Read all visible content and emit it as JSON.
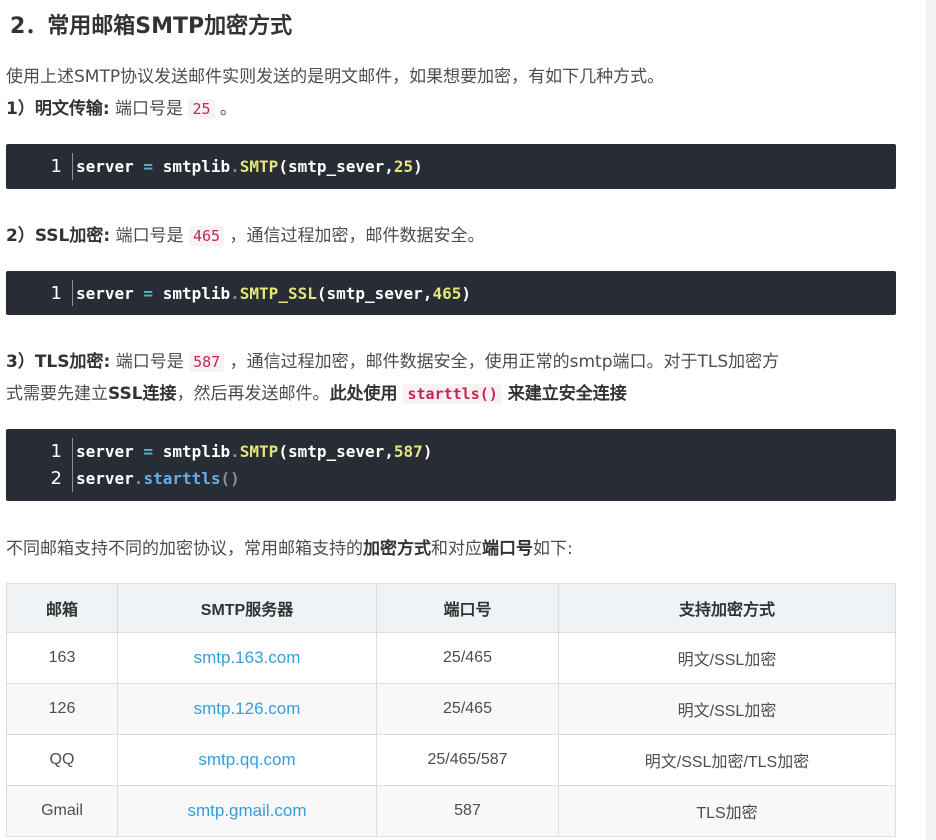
{
  "heading": "2．常用邮箱SMTP加密方式",
  "intro": "使用上述SMTP协议发送邮件实则发送的是明文邮件，如果想要加密，有如下几种方式。",
  "item1": {
    "label": "1）明文传输:",
    "text_before": " 端口号是 ",
    "port": "25",
    "text_after": " 。"
  },
  "code1": {
    "line_no": "1",
    "obj": "server",
    "eq": " = ",
    "mod": "smtplib",
    "dot": ".",
    "fn": "SMTP",
    "args_open": "(smtp_sever,",
    "num": "25",
    "args_close": ")"
  },
  "item2": {
    "label": "2）SSL加密:",
    "text_before": " 端口号是 ",
    "port": "465",
    "text_after": " ，通信过程加密，邮件数据安全。"
  },
  "code2": {
    "line_no": "1",
    "obj": "server",
    "eq": " = ",
    "mod": "smtplib",
    "dot": ".",
    "fn": "SMTP_SSL",
    "args_open": "(smtp_sever,",
    "num": "465",
    "args_close": ")"
  },
  "item3": {
    "label": "3）TLS加密:",
    "text_before": " 端口号是 ",
    "port": "587",
    "text_after": " ，通信过程加密，邮件数据安全，使用正常的smtp端口。对于TLS加密方",
    "line2_a": "式需要先建立",
    "line2_b": "SSL连接",
    "line2_c": "，然后再发送邮件。",
    "line2_d": "此处使用 ",
    "line2_code": "starttls()",
    "line2_e": " 来建立安全连接"
  },
  "code3": {
    "line1": {
      "line_no": "1",
      "obj": "server",
      "eq": " = ",
      "mod": "smtplib",
      "dot": ".",
      "fn": "SMTP",
      "args_open": "(smtp_sever,",
      "num": "587",
      "args_close": ")"
    },
    "line2": {
      "line_no": "2",
      "obj": "server",
      "dot": ".",
      "call": "starttls",
      "parens": "()"
    }
  },
  "summary": {
    "a": "不同邮箱支持不同的加密协议，常用邮箱支持的",
    "b": "加密方式",
    "c": "和对应",
    "d": "端口号",
    "e": "如下:"
  },
  "table": {
    "headers": [
      "邮箱",
      "SMTP服务器",
      "端口号",
      "支持加密方式"
    ],
    "rows": [
      [
        "163",
        "smtp.163.com",
        "25/465",
        "明文/SSL加密"
      ],
      [
        "126",
        "smtp.126.com",
        "25/465",
        "明文/SSL加密"
      ],
      [
        "QQ",
        "smtp.qq.com",
        "25/465/587",
        "明文/SSL加密/TLS加密"
      ],
      [
        "Gmail",
        "smtp.gmail.com",
        "587",
        "TLS加密"
      ]
    ]
  }
}
